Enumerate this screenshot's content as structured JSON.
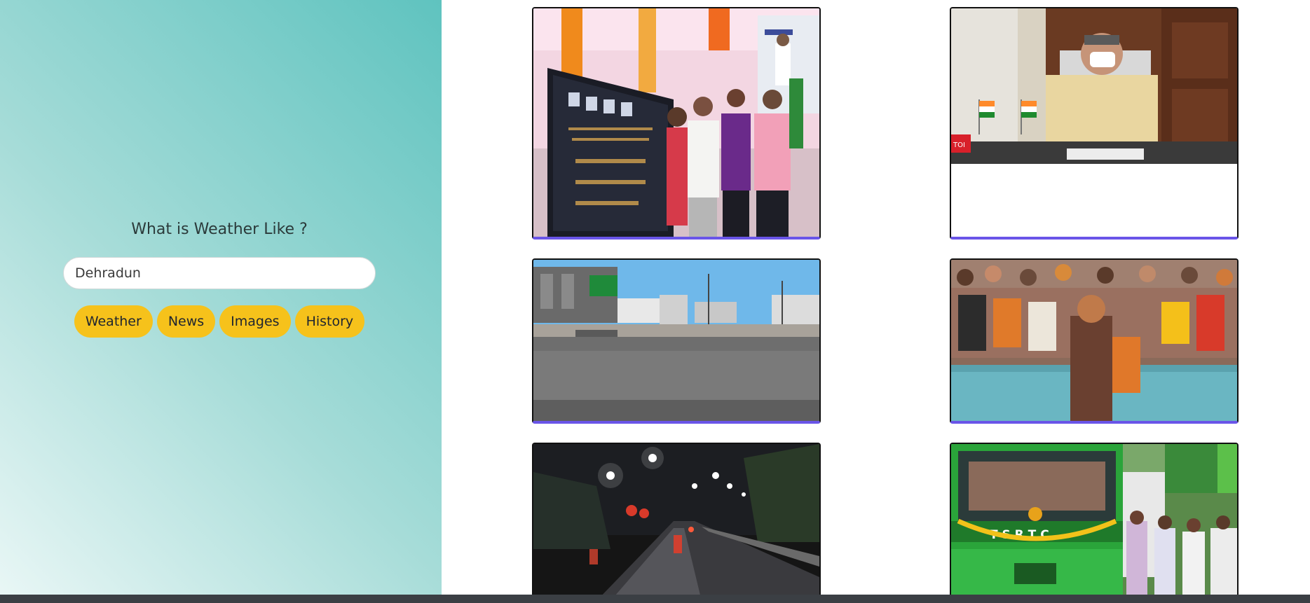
{
  "search": {
    "heading": "What is Weather Like ?",
    "value": "Dehradun"
  },
  "buttons": [
    {
      "label": "Weather"
    },
    {
      "label": "News"
    },
    {
      "label": "Images"
    },
    {
      "label": "History"
    }
  ],
  "colors": {
    "button_bg": "#f6c21b",
    "card_accent": "#6a55e8",
    "sidebar_gradient_start": "#eaf7f6",
    "sidebar_gradient_end": "#5fc3bf"
  },
  "gallery": {
    "images": [
      {
        "name": "plaque-unveiling-photo"
      },
      {
        "name": "official-video-conference-photo",
        "badge": "TOI"
      },
      {
        "name": "empty-road-daytime-photo"
      },
      {
        "name": "river-ganga-sadhu-photo"
      },
      {
        "name": "empty-road-night-photo"
      },
      {
        "name": "green-bus-inauguration-photo",
        "bus_text": "T S R T C"
      }
    ]
  }
}
